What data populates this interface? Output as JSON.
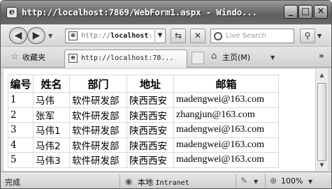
{
  "window": {
    "title": "http://localhost:7869/WebForm1.aspx - Windo...",
    "buttons": {
      "minimize": "_",
      "maximize": "□",
      "close": "✕"
    }
  },
  "address_bar": {
    "url_prefix": "http://",
    "url_host": "localhost",
    "url_rest": ":7",
    "search_placeholder": "Live Search"
  },
  "favorites_bar": {
    "favorites_label": "收藏夹",
    "tab_label": "http://localhost:78...",
    "home_label": "主页(M)"
  },
  "table": {
    "headers": [
      "编号",
      "姓名",
      "部门",
      "地址",
      "邮箱"
    ],
    "rows": [
      [
        "1",
        "马伟",
        "软件研发部",
        "陕西西安",
        "madengwei@163.com"
      ],
      [
        "2",
        "张军",
        "软件研发部",
        "陕西西安",
        "zhangjun@163.com"
      ],
      [
        "3",
        "马伟1",
        "软件研发部",
        "陕西西安",
        "madengwei@163.com"
      ],
      [
        "4",
        "马伟2",
        "软件研发部",
        "陕西西安",
        "madengwei@163.com"
      ],
      [
        "5",
        "马伟3",
        "软件研发部",
        "陕西西安",
        "madengwei@163.com"
      ]
    ]
  },
  "status_bar": {
    "status": "完成",
    "zone_cn": "本地",
    "zone_en": "Intranet",
    "zoom": "100%"
  },
  "icons": {
    "page": "page-icon",
    "back": "back-arrow-icon",
    "forward": "forward-arrow-icon",
    "refresh": "refresh-icon",
    "stop": "stop-icon",
    "search": "search-icon",
    "star": "favorites-star-icon",
    "home": "home-icon",
    "zone": "intranet-zone-icon",
    "zoom": "zoom-icon"
  }
}
